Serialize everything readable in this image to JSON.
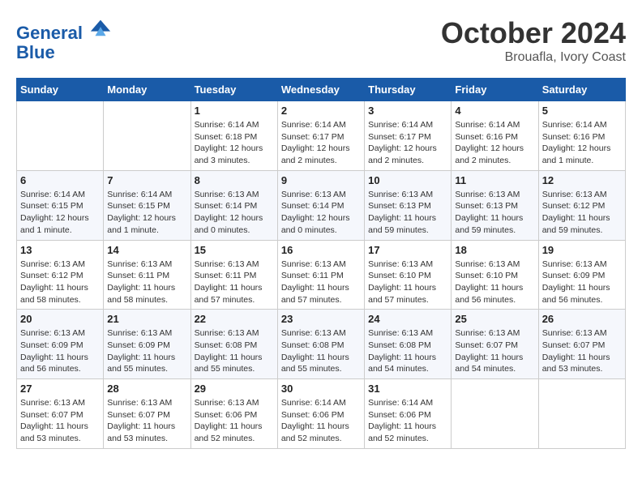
{
  "header": {
    "logo_line1": "General",
    "logo_line2": "Blue",
    "month_title": "October 2024",
    "location": "Brouafla, Ivory Coast"
  },
  "weekdays": [
    "Sunday",
    "Monday",
    "Tuesday",
    "Wednesday",
    "Thursday",
    "Friday",
    "Saturday"
  ],
  "weeks": [
    [
      {
        "day": "",
        "info": ""
      },
      {
        "day": "",
        "info": ""
      },
      {
        "day": "1",
        "info": "Sunrise: 6:14 AM\nSunset: 6:18 PM\nDaylight: 12 hours and 3 minutes."
      },
      {
        "day": "2",
        "info": "Sunrise: 6:14 AM\nSunset: 6:17 PM\nDaylight: 12 hours and 2 minutes."
      },
      {
        "day": "3",
        "info": "Sunrise: 6:14 AM\nSunset: 6:17 PM\nDaylight: 12 hours and 2 minutes."
      },
      {
        "day": "4",
        "info": "Sunrise: 6:14 AM\nSunset: 6:16 PM\nDaylight: 12 hours and 2 minutes."
      },
      {
        "day": "5",
        "info": "Sunrise: 6:14 AM\nSunset: 6:16 PM\nDaylight: 12 hours and 1 minute."
      }
    ],
    [
      {
        "day": "6",
        "info": "Sunrise: 6:14 AM\nSunset: 6:15 PM\nDaylight: 12 hours and 1 minute."
      },
      {
        "day": "7",
        "info": "Sunrise: 6:14 AM\nSunset: 6:15 PM\nDaylight: 12 hours and 1 minute."
      },
      {
        "day": "8",
        "info": "Sunrise: 6:13 AM\nSunset: 6:14 PM\nDaylight: 12 hours and 0 minutes."
      },
      {
        "day": "9",
        "info": "Sunrise: 6:13 AM\nSunset: 6:14 PM\nDaylight: 12 hours and 0 minutes."
      },
      {
        "day": "10",
        "info": "Sunrise: 6:13 AM\nSunset: 6:13 PM\nDaylight: 11 hours and 59 minutes."
      },
      {
        "day": "11",
        "info": "Sunrise: 6:13 AM\nSunset: 6:13 PM\nDaylight: 11 hours and 59 minutes."
      },
      {
        "day": "12",
        "info": "Sunrise: 6:13 AM\nSunset: 6:12 PM\nDaylight: 11 hours and 59 minutes."
      }
    ],
    [
      {
        "day": "13",
        "info": "Sunrise: 6:13 AM\nSunset: 6:12 PM\nDaylight: 11 hours and 58 minutes."
      },
      {
        "day": "14",
        "info": "Sunrise: 6:13 AM\nSunset: 6:11 PM\nDaylight: 11 hours and 58 minutes."
      },
      {
        "day": "15",
        "info": "Sunrise: 6:13 AM\nSunset: 6:11 PM\nDaylight: 11 hours and 57 minutes."
      },
      {
        "day": "16",
        "info": "Sunrise: 6:13 AM\nSunset: 6:11 PM\nDaylight: 11 hours and 57 minutes."
      },
      {
        "day": "17",
        "info": "Sunrise: 6:13 AM\nSunset: 6:10 PM\nDaylight: 11 hours and 57 minutes."
      },
      {
        "day": "18",
        "info": "Sunrise: 6:13 AM\nSunset: 6:10 PM\nDaylight: 11 hours and 56 minutes."
      },
      {
        "day": "19",
        "info": "Sunrise: 6:13 AM\nSunset: 6:09 PM\nDaylight: 11 hours and 56 minutes."
      }
    ],
    [
      {
        "day": "20",
        "info": "Sunrise: 6:13 AM\nSunset: 6:09 PM\nDaylight: 11 hours and 56 minutes."
      },
      {
        "day": "21",
        "info": "Sunrise: 6:13 AM\nSunset: 6:09 PM\nDaylight: 11 hours and 55 minutes."
      },
      {
        "day": "22",
        "info": "Sunrise: 6:13 AM\nSunset: 6:08 PM\nDaylight: 11 hours and 55 minutes."
      },
      {
        "day": "23",
        "info": "Sunrise: 6:13 AM\nSunset: 6:08 PM\nDaylight: 11 hours and 55 minutes."
      },
      {
        "day": "24",
        "info": "Sunrise: 6:13 AM\nSunset: 6:08 PM\nDaylight: 11 hours and 54 minutes."
      },
      {
        "day": "25",
        "info": "Sunrise: 6:13 AM\nSunset: 6:07 PM\nDaylight: 11 hours and 54 minutes."
      },
      {
        "day": "26",
        "info": "Sunrise: 6:13 AM\nSunset: 6:07 PM\nDaylight: 11 hours and 53 minutes."
      }
    ],
    [
      {
        "day": "27",
        "info": "Sunrise: 6:13 AM\nSunset: 6:07 PM\nDaylight: 11 hours and 53 minutes."
      },
      {
        "day": "28",
        "info": "Sunrise: 6:13 AM\nSunset: 6:07 PM\nDaylight: 11 hours and 53 minutes."
      },
      {
        "day": "29",
        "info": "Sunrise: 6:13 AM\nSunset: 6:06 PM\nDaylight: 11 hours and 52 minutes."
      },
      {
        "day": "30",
        "info": "Sunrise: 6:14 AM\nSunset: 6:06 PM\nDaylight: 11 hours and 52 minutes."
      },
      {
        "day": "31",
        "info": "Sunrise: 6:14 AM\nSunset: 6:06 PM\nDaylight: 11 hours and 52 minutes."
      },
      {
        "day": "",
        "info": ""
      },
      {
        "day": "",
        "info": ""
      }
    ]
  ]
}
